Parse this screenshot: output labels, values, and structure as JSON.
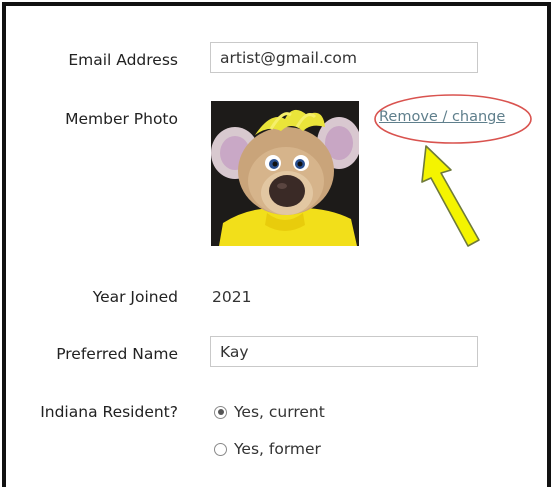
{
  "form": {
    "email": {
      "label": "Email Address",
      "value": "artist@gmail.com"
    },
    "photo": {
      "label": "Member Photo",
      "link_text": "Remove / change",
      "image_alt": "mouse-plush-photo"
    },
    "year_joined": {
      "label": "Year Joined",
      "value": "2021"
    },
    "preferred_name": {
      "label": "Preferred Name",
      "value": "Kay"
    },
    "indiana_resident": {
      "label": "Indiana Resident?",
      "options": [
        {
          "label": "Yes, current",
          "checked": true
        },
        {
          "label": "Yes, former",
          "checked": false
        }
      ]
    }
  },
  "annotations": {
    "circle_color": "#d9534f",
    "arrow_fill": "#f4f400",
    "arrow_stroke": "#6f7a3a"
  }
}
